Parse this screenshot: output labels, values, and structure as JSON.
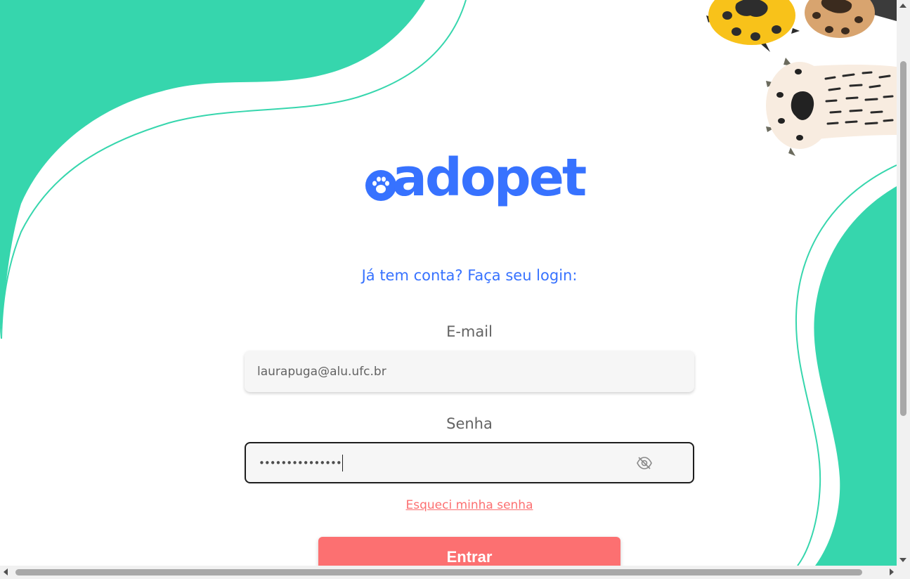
{
  "colors": {
    "accent": "#3772ff",
    "teal": "#36d6ad",
    "coral": "#fc7071",
    "label_gray": "#636363",
    "field_bg": "#f6f6f6"
  },
  "brand": {
    "logo_text": "adopet",
    "logo_icon": "paw-icon"
  },
  "login": {
    "subtitle": "Já tem conta? Faça seu login:",
    "email": {
      "label": "E-mail",
      "value": "laurapuga@alu.ufc.br"
    },
    "password": {
      "label": "Senha",
      "masked_value": "•••••••••••••••",
      "toggle_icon": "eye-off-icon"
    },
    "forgot_link": "Esqueci minha senha",
    "submit_label": "Entrar"
  },
  "decorations": {
    "icons": [
      "yellow-paw-icon",
      "tan-paw-icon",
      "striped-paw-icon"
    ]
  }
}
